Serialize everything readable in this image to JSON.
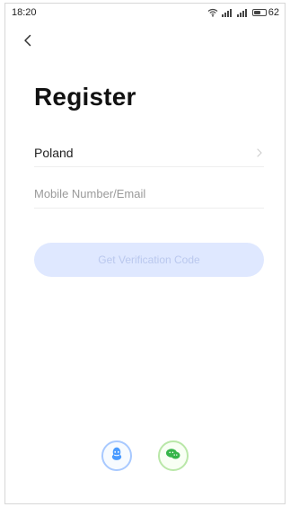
{
  "status_bar": {
    "time": "18:20",
    "battery": "62",
    "battery_level": 0.62,
    "icons": [
      "wifi-icon",
      "signal-icon",
      "signal-icon",
      "battery-icon"
    ]
  },
  "navigation": {
    "back_icon": "chevron-left-icon"
  },
  "page": {
    "title": "Register"
  },
  "country": {
    "value": "Poland",
    "icon": "chevron-right-icon"
  },
  "input": {
    "placeholder": "Mobile Number/Email",
    "value": ""
  },
  "primary_action": {
    "label": "Get Verification Code"
  },
  "social": {
    "items": [
      {
        "icon": "qq-icon",
        "accent": "#4a9bff"
      },
      {
        "icon": "wechat-icon",
        "accent": "#36b54a"
      }
    ]
  }
}
